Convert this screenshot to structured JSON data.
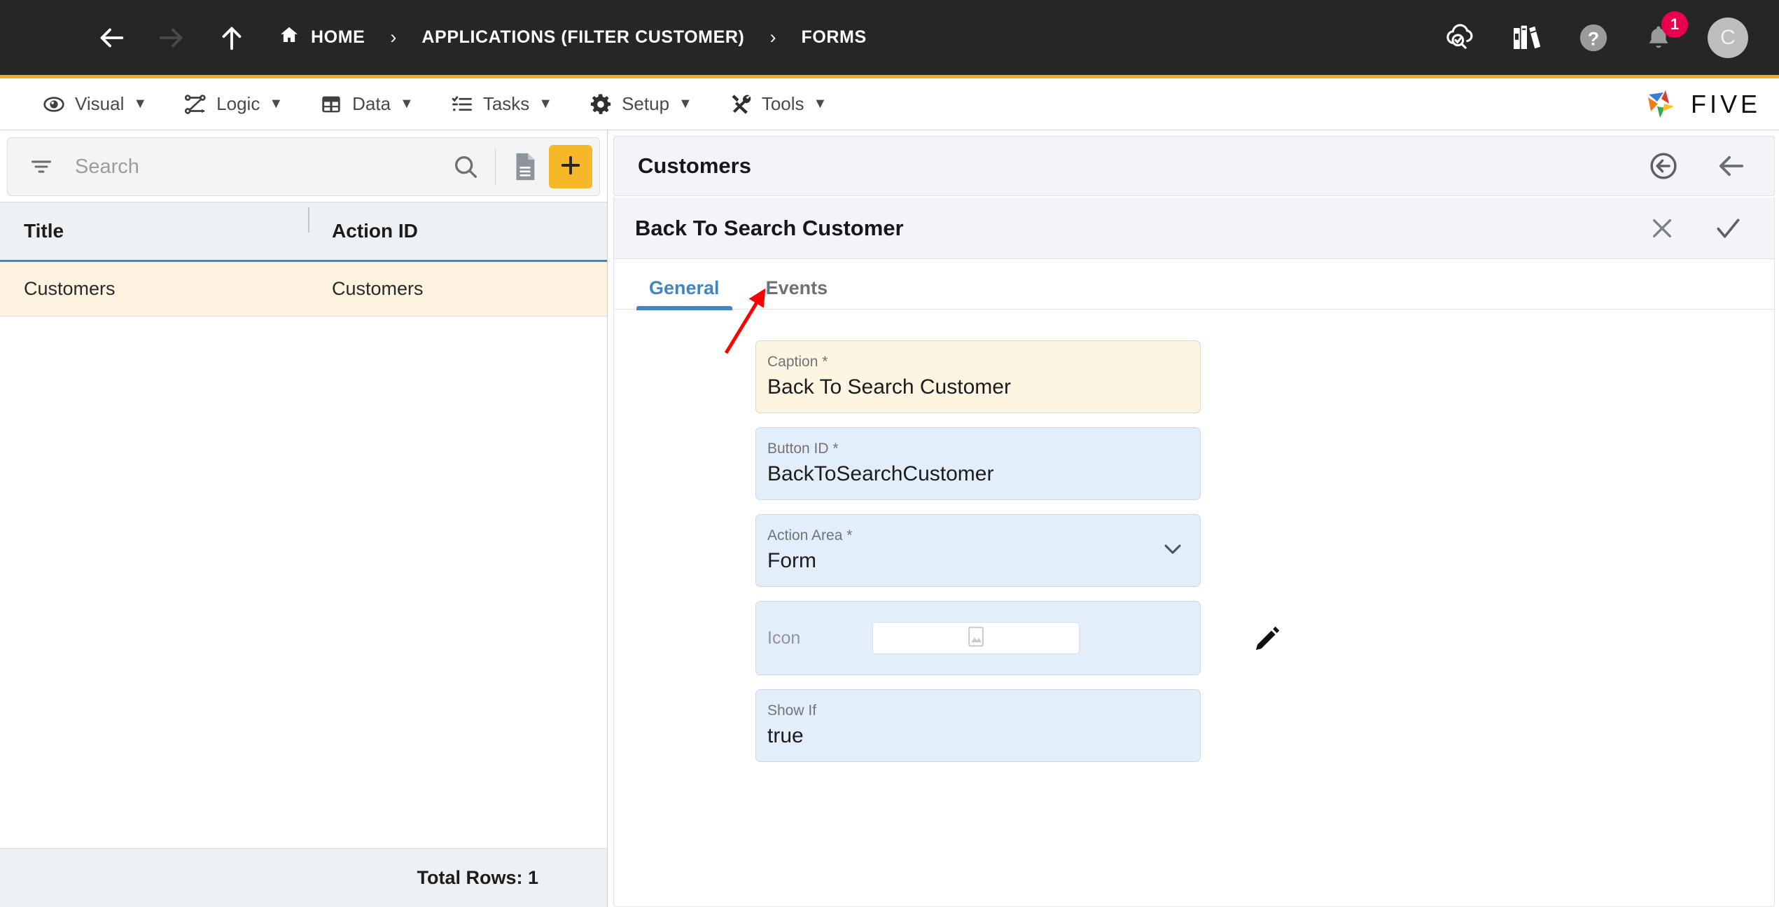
{
  "topbar": {
    "menu_icon": "hamburger-icon",
    "back_icon": "arrow-left-icon",
    "forward_icon": "arrow-right-icon",
    "up_icon": "arrow-up-icon",
    "breadcrumbs": [
      {
        "label": "HOME",
        "icon": "home-icon"
      },
      {
        "label": "APPLICATIONS (FILTER CUSTOMER)",
        "icon": ""
      },
      {
        "label": "FORMS",
        "icon": ""
      }
    ],
    "separator": "›",
    "actions": [
      {
        "name": "cloud-check-search-icon"
      },
      {
        "name": "books-library-icon"
      },
      {
        "name": "help-icon"
      },
      {
        "name": "notifications-bell-icon",
        "badge": "1"
      }
    ],
    "avatar_letter": "C",
    "accent_color": "#f2ad21",
    "badge_color": "#e8004f",
    "background": "#262626"
  },
  "menubar": {
    "items": [
      {
        "label": "Visual",
        "icon": "eye-icon",
        "caret": "▼"
      },
      {
        "label": "Logic",
        "icon": "logic-flow-icon",
        "caret": "▼"
      },
      {
        "label": "Data",
        "icon": "table-grid-icon",
        "caret": "▼"
      },
      {
        "label": "Tasks",
        "icon": "checklist-icon",
        "caret": "▼"
      },
      {
        "label": "Setup",
        "icon": "gear-icon",
        "caret": "▼"
      },
      {
        "label": "Tools",
        "icon": "tools-wrench-screwdriver-icon",
        "caret": "▼"
      }
    ],
    "logo_text": "FIVE",
    "logo_colors": [
      "#3b7ddd",
      "#e03b2f",
      "#f07e18",
      "#2fa84f",
      "#f5c01f"
    ]
  },
  "left_panel": {
    "search": {
      "placeholder": "Search",
      "value": "",
      "filter_icon": "filter-icon",
      "search_icon": "search-icon",
      "document_icon": "document-icon",
      "add_icon": "plus-icon",
      "add_button_color": "#f6b829"
    },
    "grid": {
      "columns": [
        "Title",
        "Action ID"
      ],
      "rows": [
        {
          "title": "Customers",
          "action_id": "Customers",
          "selected": true
        }
      ],
      "footer": "Total Rows: 1",
      "selected_row_color": "#fdf3e0",
      "header_underline_color": "#4285c7"
    }
  },
  "right_panel": {
    "header": {
      "title": "Customers",
      "actions": [
        {
          "name": "back-circle-icon"
        },
        {
          "name": "arrow-left-icon"
        }
      ]
    },
    "form": {
      "title": "Back To Search Customer",
      "actions": [
        {
          "name": "close-icon",
          "glyph": "✕"
        },
        {
          "name": "confirm-check-icon",
          "glyph": "✓"
        }
      ],
      "tabs": [
        {
          "label": "General",
          "active": true
        },
        {
          "label": "Events",
          "active": false
        }
      ],
      "active_tab_color": "#4285c7",
      "fields": [
        {
          "name": "caption-field",
          "label": "Caption *",
          "value": "Back To Search Customer",
          "modified": true,
          "type": "text"
        },
        {
          "name": "button-id-field",
          "label": "Button ID *",
          "value": "BackToSearchCustomer",
          "modified": false,
          "type": "text"
        },
        {
          "name": "action-area-field",
          "label": "Action Area *",
          "value": "Form",
          "modified": false,
          "type": "select",
          "chevron": "chevron-down-icon"
        },
        {
          "name": "icon-field",
          "label": "Icon",
          "value": "",
          "modified": false,
          "type": "image-picker",
          "placeholder_icon": "image-placeholder-icon",
          "edit_icon": "pencil-edit-icon"
        },
        {
          "name": "show-if-field",
          "label": "Show If",
          "value": "true",
          "modified": false,
          "type": "text"
        }
      ]
    }
  },
  "annotation": {
    "name": "events-tab-pointer-arrow",
    "color": "#ff0000",
    "points_to": "Events"
  }
}
